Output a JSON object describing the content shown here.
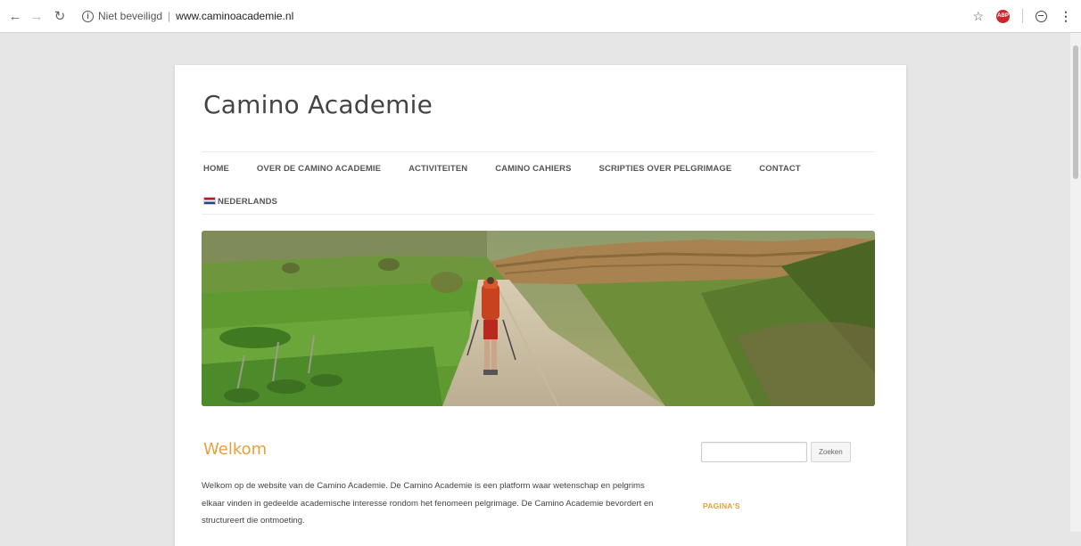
{
  "browser": {
    "security_label": "Niet beveiligd",
    "separator": "|",
    "url": "www.caminoacademie.nl",
    "adblock_label": "ABP"
  },
  "site": {
    "title": "Camino Academie"
  },
  "menu": {
    "items": [
      {
        "label": "HOME"
      },
      {
        "label": "OVER DE CAMINO ACADEMIE"
      },
      {
        "label": "ACTIVITEITEN"
      },
      {
        "label": "CAMINO CAHIERS"
      },
      {
        "label": "SCRIPTIES OVER PELGRIMAGE"
      },
      {
        "label": "CONTACT"
      }
    ],
    "language": "NEDERLANDS"
  },
  "content": {
    "title": "Welkom",
    "body": "Welkom op de website van de Camino Academie. De Camino Academie is een platform waar wetenschap en pelgrims elkaar vinden in gedeelde academische interesse rondom het fenomeen pelgrimage. De Camino Academie bevordert en structureert die ontmoeting."
  },
  "sidebar": {
    "search_button": "Zoeken",
    "search_value": "",
    "widget_title": "PAGINA'S"
  },
  "colors": {
    "accent": "#e8a03c",
    "flag": [
      "#ae1c28",
      "#ffffff",
      "#21468b"
    ]
  }
}
